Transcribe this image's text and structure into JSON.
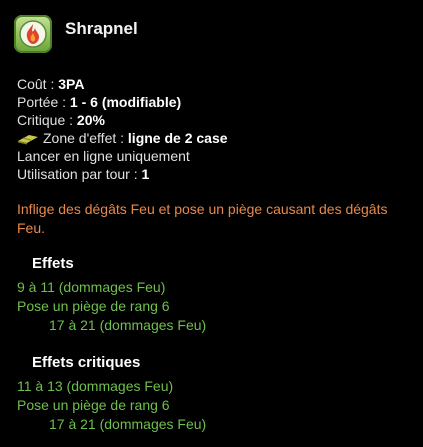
{
  "spell": {
    "title": "Shrapnel",
    "icon": "flame-icon",
    "accent_color": "#e8894a",
    "effect_color": "#6fbf4e"
  },
  "stats": {
    "cost_label": "Coût :",
    "cost_value": "3PA",
    "range_label": "Portée :",
    "range_value": "1 - 6 (modifiable)",
    "critical_label": "Critique :",
    "critical_value": "20%",
    "zone_label": "Zone d'effet :",
    "zone_value": "ligne de 2 case",
    "line_only": "Lancer en ligne uniquement",
    "uses_label": "Utilisation par tour :",
    "uses_value": "1"
  },
  "description": "Inflige des dégâts Feu et pose un piège causant des dégâts Feu.",
  "effects": {
    "title": "Effets",
    "lines": [
      "9 à 11 (dommages Feu)",
      "Pose un piège de rang 6",
      "17 à 21 (dommages Feu)"
    ]
  },
  "critical_effects": {
    "title": "Effets critiques",
    "lines": [
      "11 à 13 (dommages Feu)",
      "Pose un piège de rang 6",
      "17 à 21 (dommages Feu)"
    ]
  }
}
